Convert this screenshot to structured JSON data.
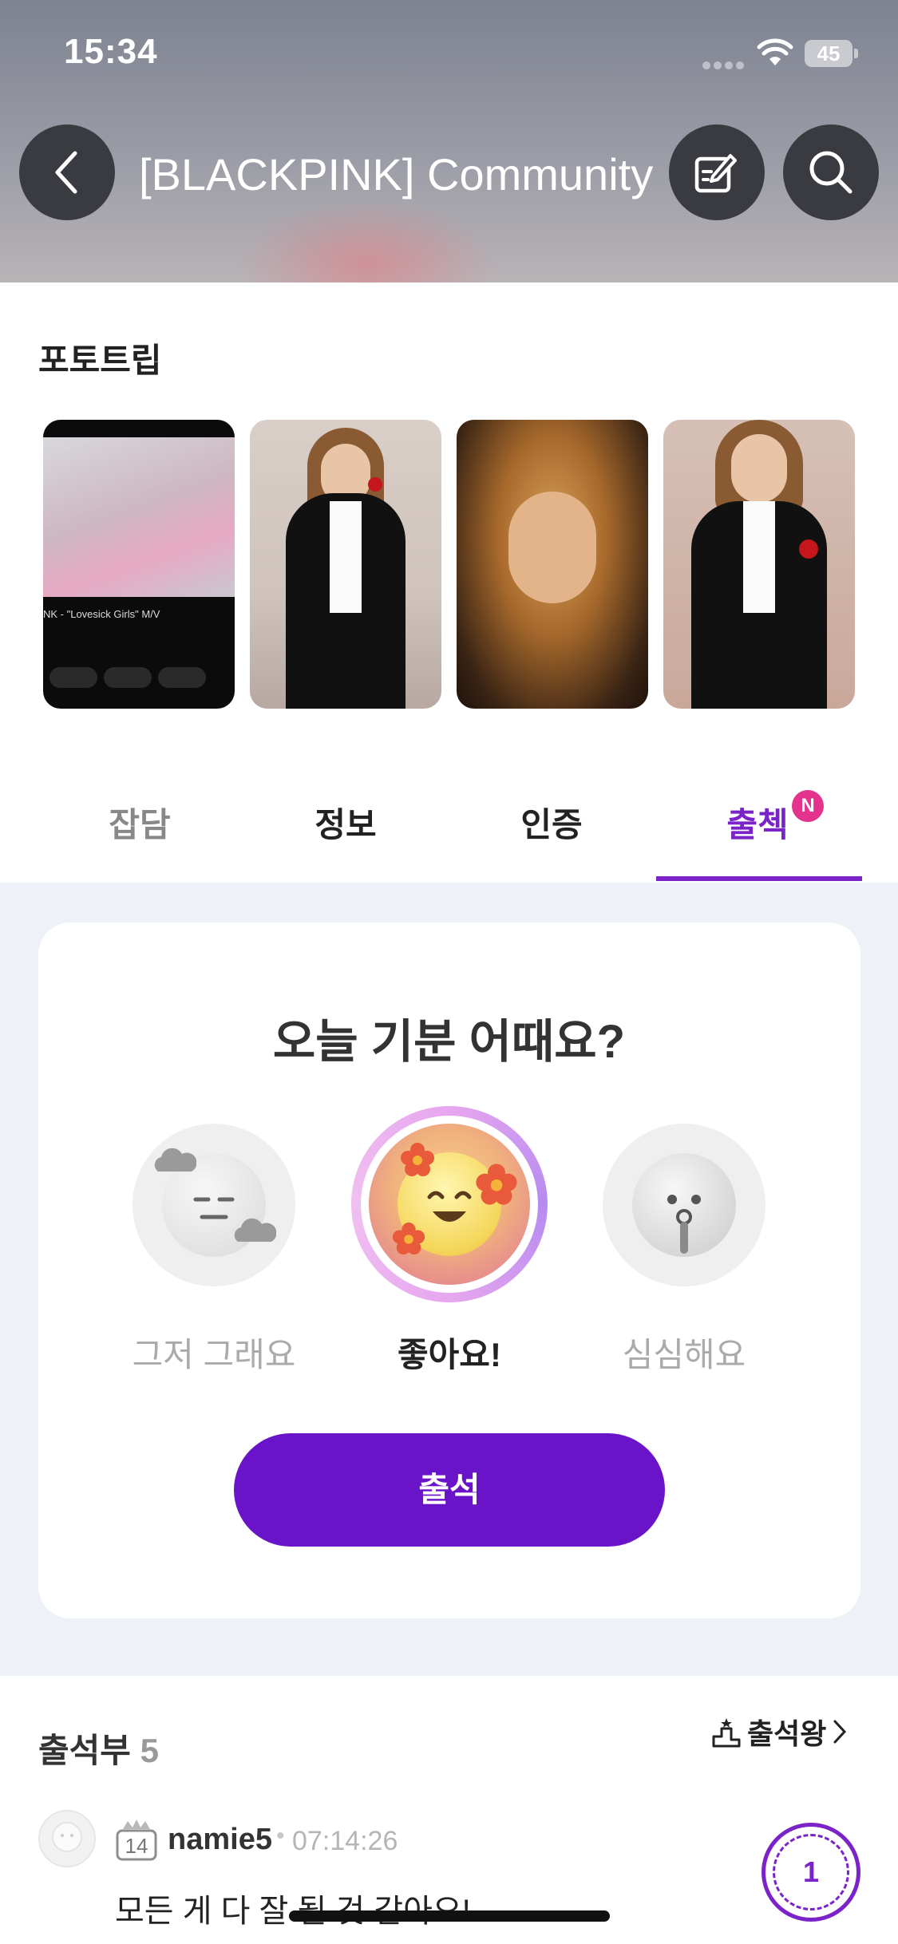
{
  "status_bar": {
    "time": "15:34",
    "battery": "45"
  },
  "header": {
    "title": "[BLACKPINK] Community"
  },
  "photo_trip": {
    "title": "포토트립",
    "photos": [
      {
        "caption_line": "NK - \"Lovesick Girls\" M/V"
      },
      {
        "caption_line": ""
      },
      {
        "caption_line": ""
      },
      {
        "caption_line": ""
      }
    ]
  },
  "tabs": [
    {
      "label": "잡담",
      "active": false
    },
    {
      "label": "정보",
      "active": false
    },
    {
      "label": "인증",
      "active": false
    },
    {
      "label": "출첵",
      "active": true,
      "badge": "N"
    }
  ],
  "mood_card": {
    "title": "오늘 기분 어때요?",
    "options": [
      {
        "label": "그저 그래요",
        "icon": "meh-face-icon",
        "selected": false
      },
      {
        "label": "좋아요!",
        "icon": "happy-face-icon",
        "selected": true
      },
      {
        "label": "심심해요",
        "icon": "bored-face-icon",
        "selected": false
      }
    ],
    "button_label": "출석"
  },
  "attendance": {
    "title": "출석부",
    "count": "5",
    "king_link": "출석왕",
    "entries": [
      {
        "level": "14",
        "username": "namie5",
        "time": "07:14:26",
        "comment": "모든 게 다 잘 될 것 같아요!",
        "rank": "1"
      }
    ]
  },
  "colors": {
    "accent": "#7a23c9",
    "button": "#6a14c9",
    "badge": "#e4338d",
    "gray_bg": "#eef1f8"
  }
}
